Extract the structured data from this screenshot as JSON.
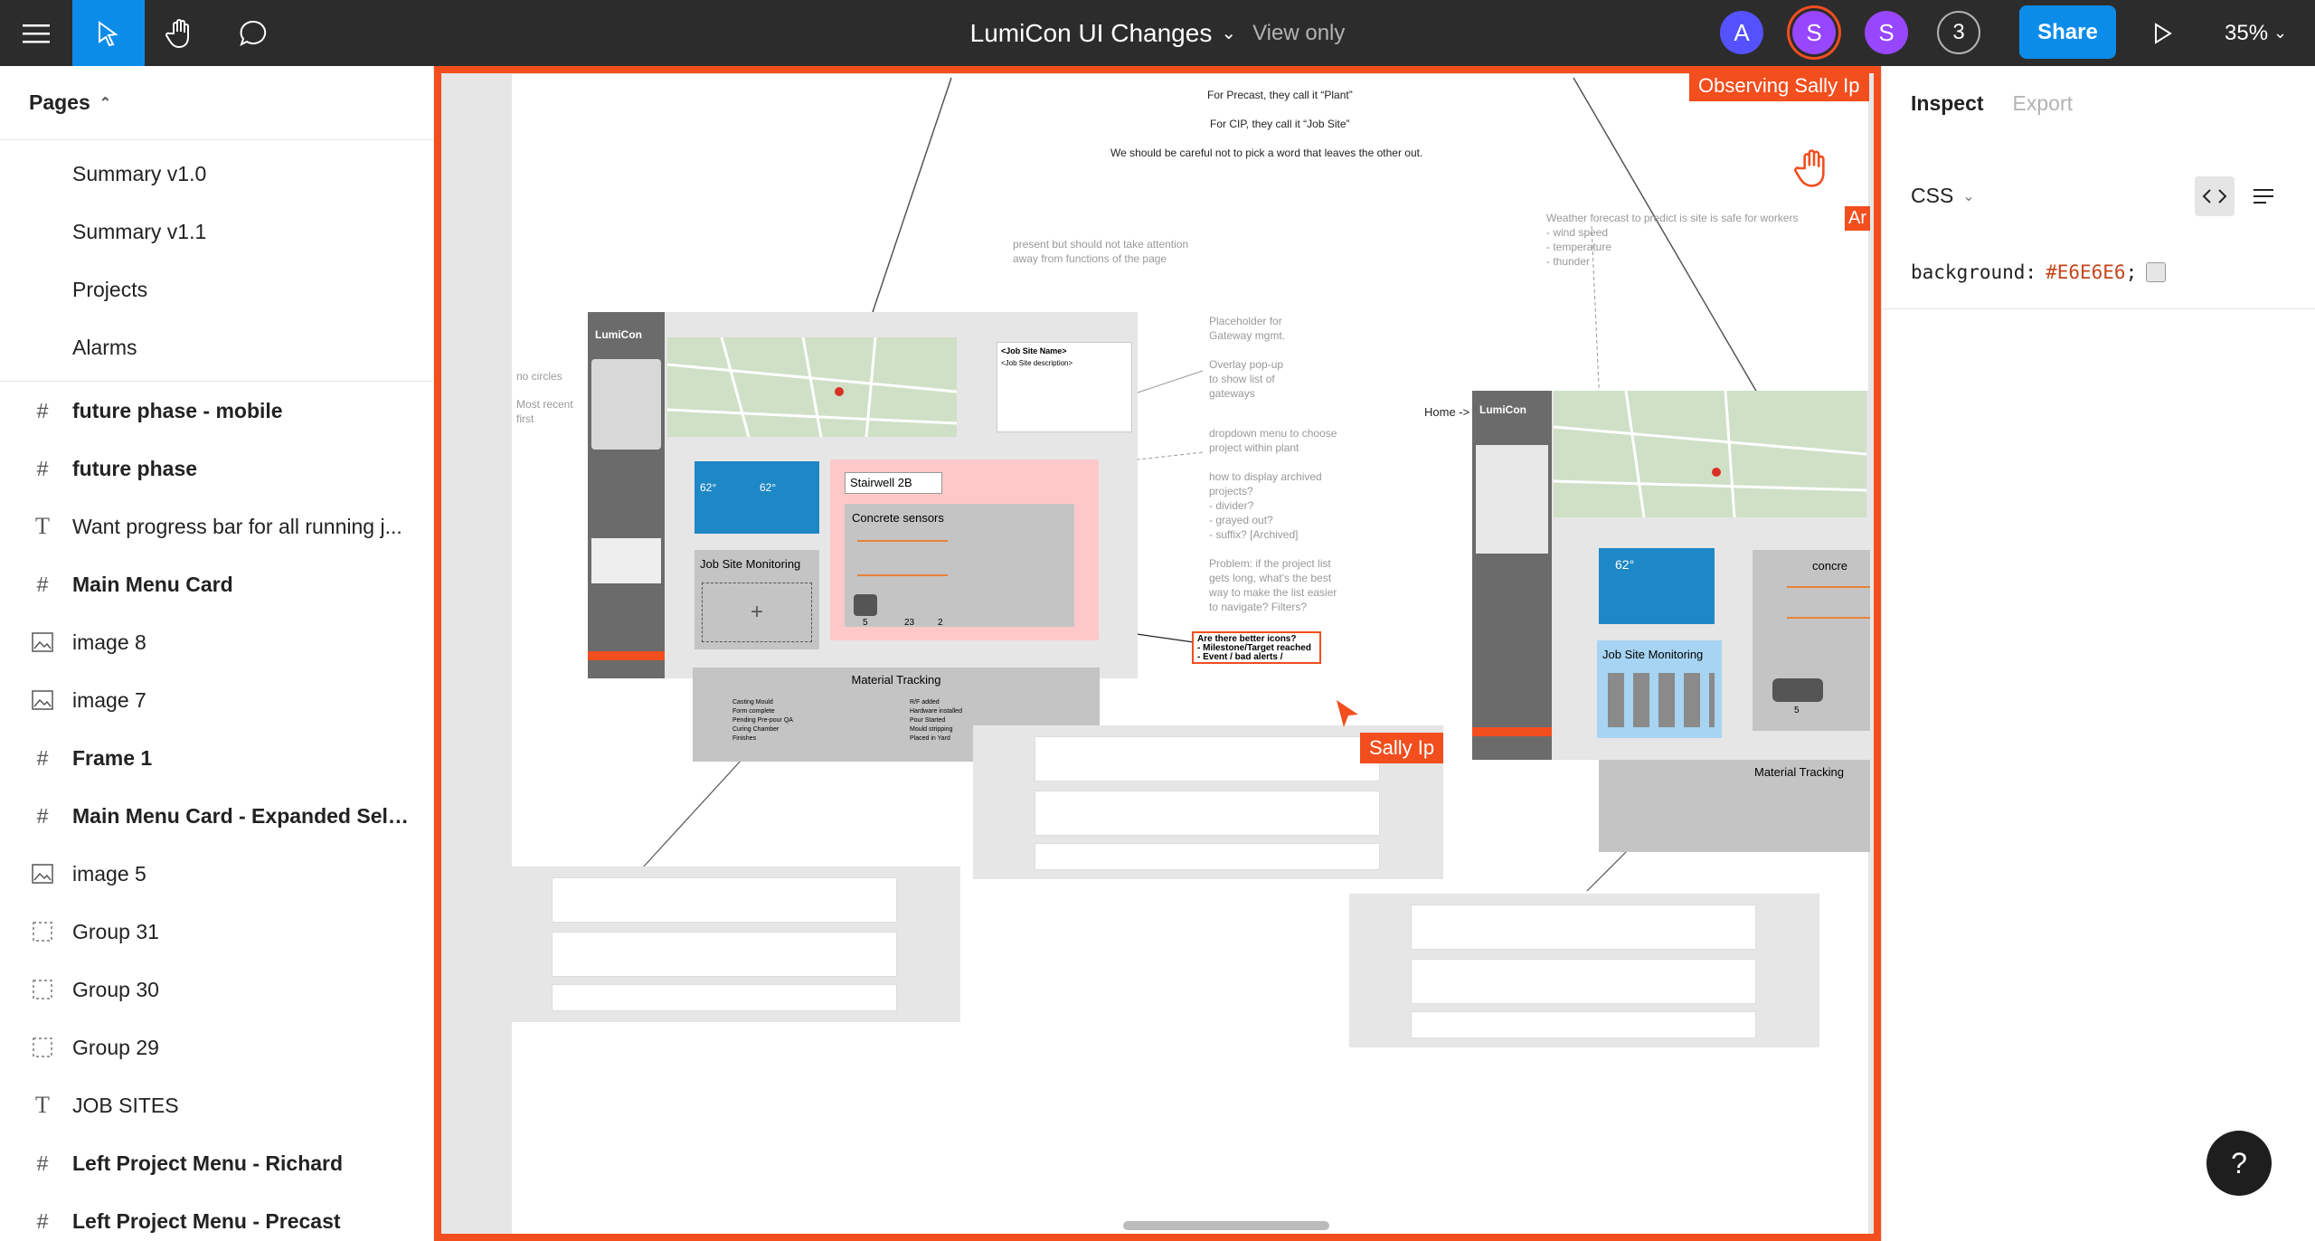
{
  "topbar": {
    "file_title": "LumiCon UI Changes",
    "view_mode": "View only",
    "avatars": [
      "A",
      "S",
      "S"
    ],
    "extra_count": "3",
    "share_label": "Share",
    "zoom_level": "35%"
  },
  "left": {
    "pages_label": "Pages",
    "pages": [
      "Summary v1.0",
      "Summary v1.1",
      "Projects",
      "Alarms"
    ],
    "layers": [
      {
        "type": "frame",
        "label": "future phase - mobile"
      },
      {
        "type": "frame",
        "label": "future phase"
      },
      {
        "type": "text",
        "label": "Want progress bar for all running j..."
      },
      {
        "type": "frame",
        "label": "Main Menu Card"
      },
      {
        "type": "image",
        "label": "image 8"
      },
      {
        "type": "image",
        "label": "image 7"
      },
      {
        "type": "frame",
        "label": "Frame 1"
      },
      {
        "type": "frame",
        "label": "Main Menu Card - Expanded Sele..."
      },
      {
        "type": "image",
        "label": "image 5"
      },
      {
        "type": "group",
        "label": "Group 31"
      },
      {
        "type": "group",
        "label": "Group 30"
      },
      {
        "type": "group",
        "label": "Group 29"
      },
      {
        "type": "text",
        "label": "JOB SITES"
      },
      {
        "type": "frame",
        "label": "Left Project Menu - Richard"
      },
      {
        "type": "frame",
        "label": "Left Project Menu - Precast"
      }
    ]
  },
  "canvas": {
    "observing_label": "Observing Sally Ip",
    "cursor_label": "Sally Ip",
    "cursor_label_2": "Ar",
    "notes": {
      "precast": "For Precast, they call it “Plant”",
      "cip": "For CIP, they call it “Job Site”",
      "careful": "We should be careful not to pick a word that leaves the other out.",
      "present": "present but should not take attention",
      "away": "away from functions of the page",
      "weather1": "Weather forecast to predict is site is safe for workers",
      "weather2": "- wind speed",
      "weather3": "- temperature",
      "weather4": "- thunder",
      "gateway1": "Placeholder for",
      "gateway2": "Gateway mgmt.",
      "popup1": "Overlay pop-up",
      "popup2": "to show list of",
      "popup3": "gateways",
      "dropdown1": "dropdown menu to choose",
      "dropdown2": "project within plant",
      "archive1": "how to display archived",
      "archive2": "projects?",
      "archive3": "- divider?",
      "archive4": "- grayed out?",
      "archive5": "- suffix? [Archived]",
      "problem1": "Problem: if the project list",
      "problem2": "gets long, what's the best",
      "problem3": "way to make the list easier",
      "problem4": "to navigate? Filters?",
      "no_circles": "no circles",
      "recent1": "Most recent",
      "recent2": "first",
      "home": "Home ->",
      "icons1": "Are there better icons?",
      "icons2": "- Milestone/Target reached",
      "icons3": "- Event / bad alerts /"
    },
    "mock1": {
      "logo": "LumiCon",
      "site_name": "<Job Site Name>",
      "site_desc": "<Job Site description>",
      "sensor_card": "Stairwell 2B",
      "concrete": "Concrete sensors",
      "job_site_monitoring": "Job Site Monitoring",
      "counts": [
        "5",
        "23",
        "2"
      ],
      "material_tracking": "Material Tracking",
      "material_left": [
        "Casting Mould",
        "Form complete",
        "Pending Pre-pour QA",
        "Curing Chamber",
        "Finishes"
      ],
      "material_right": [
        "R/F added",
        "Hardware installed",
        "Pour Started",
        "Mould stripping",
        "Placed in Yard"
      ],
      "temps": [
        "62°",
        "62°"
      ]
    },
    "mock2": {
      "logo": "LumiCon",
      "job_site_monitoring": "Job Site Monitoring",
      "concrete": "concre",
      "material_tracking": "Material Tracking",
      "count": "5",
      "temp": "62°"
    }
  },
  "right": {
    "tab_inspect": "Inspect",
    "tab_export": "Export",
    "lang": "CSS",
    "prop": "background:",
    "value": "#E6E6E6",
    "semicolon": ";"
  },
  "help_label": "?"
}
